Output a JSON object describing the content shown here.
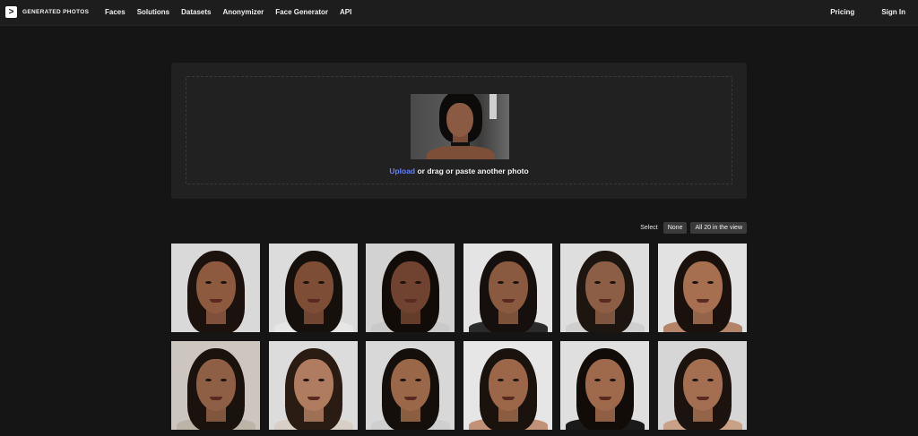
{
  "header": {
    "brand": "GENERATED PHOTOS",
    "brand_logo_glyph": ">",
    "nav": [
      "Faces",
      "Solutions",
      "Datasets",
      "Anonymizer",
      "Face Generator",
      "API"
    ],
    "right_nav": [
      "Pricing",
      "Sign In"
    ]
  },
  "upload": {
    "link_text": "Upload",
    "rest_text": " or drag or paste another photo",
    "link_color": "#5f80ff"
  },
  "select": {
    "label": "Select",
    "none_label": "None",
    "all_label": "All 20 in the view"
  },
  "faces": [
    {
      "bg": "#d9d9d9",
      "skin": "#8d5a40",
      "hair": "#1b120d",
      "top": "#d9d9d9"
    },
    {
      "bg": "#dcdcdc",
      "skin": "#7d4d36",
      "hair": "#16100c",
      "top": "#e6e6e6"
    },
    {
      "bg": "#d2d2d2",
      "skin": "#6f432f",
      "hair": "#120c09",
      "top": "#c9c9c9"
    },
    {
      "bg": "#e4e4e4",
      "skin": "#8a5a40",
      "hair": "#15100d",
      "top": "#2b2b2b"
    },
    {
      "bg": "#dedede",
      "skin": "#8c5e46",
      "hair": "#1d1510",
      "top": "#cfcfcf"
    },
    {
      "bg": "#e2e2e2",
      "skin": "#a56f50",
      "hair": "#1a110c",
      "top": "#b48469"
    },
    {
      "bg": "#ccc6bf",
      "skin": "#8f5f45",
      "hair": "#1a120d",
      "top": "#bdb4a8"
    },
    {
      "bg": "#dcdcdc",
      "skin": "#b07c5f",
      "hair": "#2a1c13",
      "top": "#d8d0c6"
    },
    {
      "bg": "#d8d8d8",
      "skin": "#9a6748",
      "hair": "#150f0b",
      "top": "#cfcfcf"
    },
    {
      "bg": "#e6e6e6",
      "skin": "#9c6649",
      "hair": "#1a120d",
      "top": "#c19278"
    },
    {
      "bg": "#dfdfdf",
      "skin": "#9f6a4b",
      "hair": "#120c09",
      "top": "#1a1a1a"
    },
    {
      "bg": "#d6d6d6",
      "skin": "#a46f50",
      "hair": "#1c130e",
      "top": "#c9a187"
    }
  ]
}
